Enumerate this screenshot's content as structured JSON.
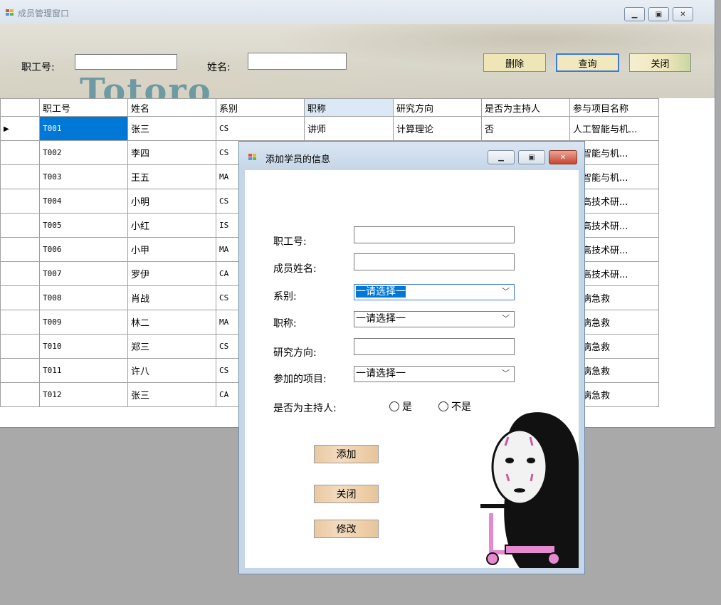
{
  "main_window": {
    "title": "成员管理窗口",
    "search": {
      "id_label": "职工号:",
      "id_value": "",
      "name_label": "姓名:",
      "name_value": ""
    },
    "buttons": {
      "delete": "删除",
      "query": "查询",
      "close": "关闭"
    },
    "watermark": "Totoro"
  },
  "grid": {
    "columns": [
      "职工号",
      "姓名",
      "系别",
      "职称",
      "研究方向",
      "是否为主持人",
      "参与项目名称"
    ],
    "rows": [
      [
        "T001",
        "张三",
        "CS",
        "讲师",
        "计算理论",
        "否",
        "人工智能与机..."
      ],
      [
        "T002",
        "李四",
        "CS",
        "",
        "",
        "",
        "工智能与机..."
      ],
      [
        "T003",
        "王五",
        "MA",
        "",
        "",
        "",
        "工智能与机..."
      ],
      [
        "T004",
        "小明",
        "CS",
        "",
        "",
        "",
        "家高技术研..."
      ],
      [
        "T005",
        "小红",
        "IS",
        "",
        "",
        "",
        "家高技术研..."
      ],
      [
        "T006",
        "小甲",
        "MA",
        "",
        "",
        "",
        "家高技术研..."
      ],
      [
        "T007",
        "罗伊",
        "CA",
        "",
        "",
        "",
        "家高技术研..."
      ],
      [
        "T008",
        "肖战",
        "CS",
        "",
        "",
        "",
        "脏病急救"
      ],
      [
        "T009",
        "林二",
        "MA",
        "",
        "",
        "",
        "脏病急救"
      ],
      [
        "T010",
        "郑三",
        "CS",
        "",
        "",
        "",
        "脏病急救"
      ],
      [
        "T011",
        "许八",
        "CS",
        "",
        "",
        "",
        "脏病急救"
      ],
      [
        "T012",
        "张三",
        "CA",
        "",
        "",
        "",
        "脏病急救"
      ]
    ]
  },
  "dialog": {
    "title": "添加学员的信息",
    "fields": {
      "id_label": "职工号:",
      "id_value": "",
      "name_label": "成员姓名:",
      "name_value": "",
      "dept_label": "系别:",
      "dept_value": "一请选择一",
      "title_label": "职称:",
      "title_value": "一请选择一",
      "research_label": "研究方向:",
      "research_value": "",
      "project_label": "参加的项目:",
      "project_value": "一请选择一",
      "host_label": "是否为主持人:",
      "host_yes": "是",
      "host_no": "不是"
    },
    "buttons": {
      "add": "添加",
      "close": "关闭",
      "modify": "修改"
    }
  },
  "icons": {
    "minimize": "minimize-icon",
    "maximize": "maximize-icon",
    "close": "close-icon",
    "dropdown": "chevron-down-icon",
    "row_pointer": "row-pointer-icon"
  },
  "colors": {
    "selection": "#0078d7",
    "button_yellow": "#efe6b8",
    "dialog_frame": "#c5d6e8"
  }
}
